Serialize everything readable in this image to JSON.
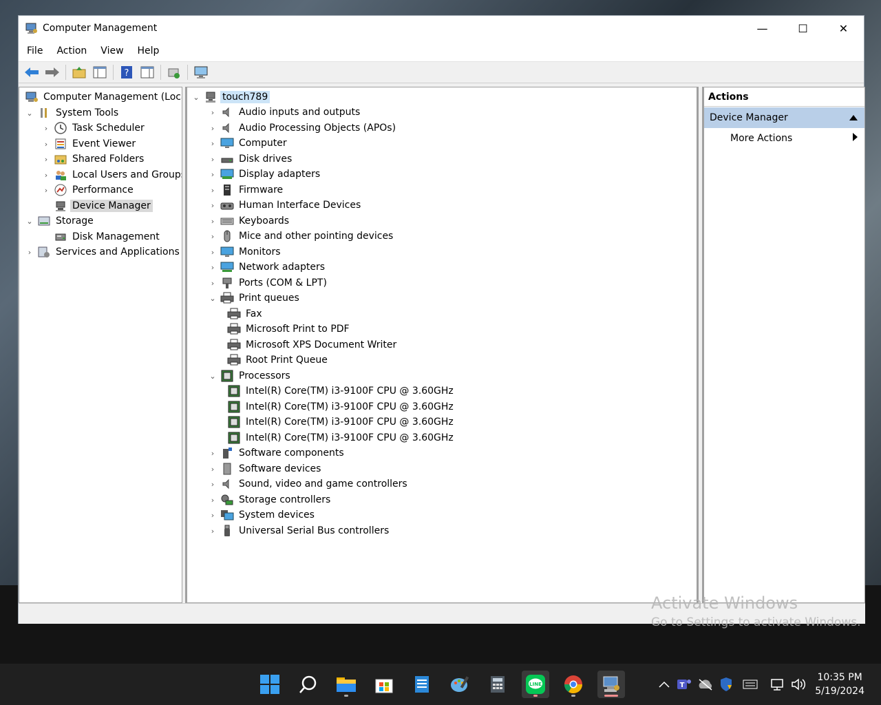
{
  "window": {
    "title": "Computer Management",
    "minimize": "—",
    "maximize": "☐",
    "close": "✕"
  },
  "menu": [
    "File",
    "Action",
    "View",
    "Help"
  ],
  "left_tree": {
    "root": "Computer Management (Local)",
    "system_tools": "System Tools",
    "task_scheduler": "Task Scheduler",
    "event_viewer": "Event Viewer",
    "shared_folders": "Shared Folders",
    "local_users": "Local Users and Groups",
    "performance": "Performance",
    "device_manager": "Device Manager",
    "storage": "Storage",
    "disk_management": "Disk Management",
    "services": "Services and Applications"
  },
  "device_tree": {
    "root": "touch789",
    "categories": [
      "Audio inputs and outputs",
      "Audio Processing Objects (APOs)",
      "Computer",
      "Disk drives",
      "Display adapters",
      "Firmware",
      "Human Interface Devices",
      "Keyboards",
      "Mice and other pointing devices",
      "Monitors",
      "Network adapters",
      "Ports (COM & LPT)"
    ],
    "print_queues": "Print queues",
    "print_items": [
      "Fax",
      "Microsoft Print to PDF",
      "Microsoft XPS Document Writer",
      "Root Print Queue"
    ],
    "processors": "Processors",
    "processor_items": [
      "Intel(R) Core(TM) i3-9100F CPU @ 3.60GHz",
      "Intel(R) Core(TM) i3-9100F CPU @ 3.60GHz",
      "Intel(R) Core(TM) i3-9100F CPU @ 3.60GHz",
      "Intel(R) Core(TM) i3-9100F CPU @ 3.60GHz"
    ],
    "categories_after": [
      "Software components",
      "Software devices",
      "Sound, video and game controllers",
      "Storage controllers",
      "System devices",
      "Universal Serial Bus controllers"
    ]
  },
  "actions": {
    "header": "Actions",
    "section": "Device Manager",
    "more": "More Actions"
  },
  "watermark": {
    "line1": "Activate Windows",
    "line2": "Go to Settings to activate Windows."
  },
  "clock": {
    "time": "10:35 PM",
    "date": "5/19/2024"
  },
  "colors": {
    "selection_blue": "#cce4f7",
    "actions_section": "#b9cfe8",
    "taskbar": "#202020"
  }
}
